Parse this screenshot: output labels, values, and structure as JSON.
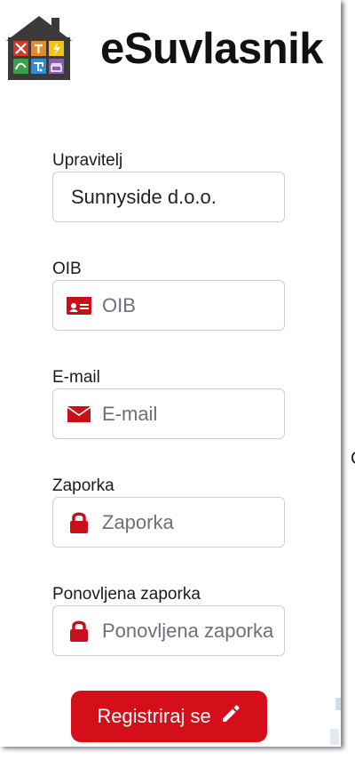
{
  "app": {
    "title": "eSuvlasnik"
  },
  "form": {
    "manager": {
      "label": "Upravitelj",
      "value": "Sunnyside d.o.o."
    },
    "oib": {
      "label": "OIB",
      "placeholder": "OIB",
      "icon": "id-card-icon"
    },
    "email": {
      "label": "E-mail",
      "placeholder": "E-mail",
      "icon": "envelope-icon"
    },
    "password": {
      "label": "Zaporka",
      "placeholder": "Zaporka",
      "icon": "lock-icon"
    },
    "password_repeat": {
      "label": "Ponovljena zaporka",
      "placeholder": "Ponovljena zaporka",
      "icon": "lock-icon"
    },
    "submit": {
      "label": "Registriraj se",
      "icon": "pencil-icon"
    }
  },
  "background": {
    "letter": "C"
  },
  "colors": {
    "accent": "#d40f1a",
    "logo_house": "#3a3a3a"
  }
}
